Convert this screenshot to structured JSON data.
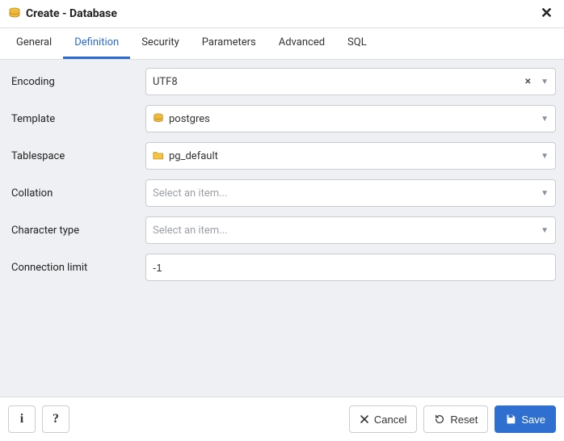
{
  "dialog": {
    "title": "Create - Database"
  },
  "tabs": {
    "general": "General",
    "definition": "Definition",
    "security": "Security",
    "parameters": "Parameters",
    "advanced": "Advanced",
    "sql": "SQL"
  },
  "form": {
    "encoding": {
      "label": "Encoding",
      "value": "UTF8"
    },
    "template": {
      "label": "Template",
      "value": "postgres"
    },
    "tablespace": {
      "label": "Tablespace",
      "value": "pg_default"
    },
    "collation": {
      "label": "Collation",
      "placeholder": "Select an item..."
    },
    "ctype": {
      "label": "Character type",
      "placeholder": "Select an item..."
    },
    "connlimit": {
      "label": "Connection limit",
      "value": "-1"
    }
  },
  "footer": {
    "cancel": "Cancel",
    "reset": "Reset",
    "save": "Save"
  }
}
